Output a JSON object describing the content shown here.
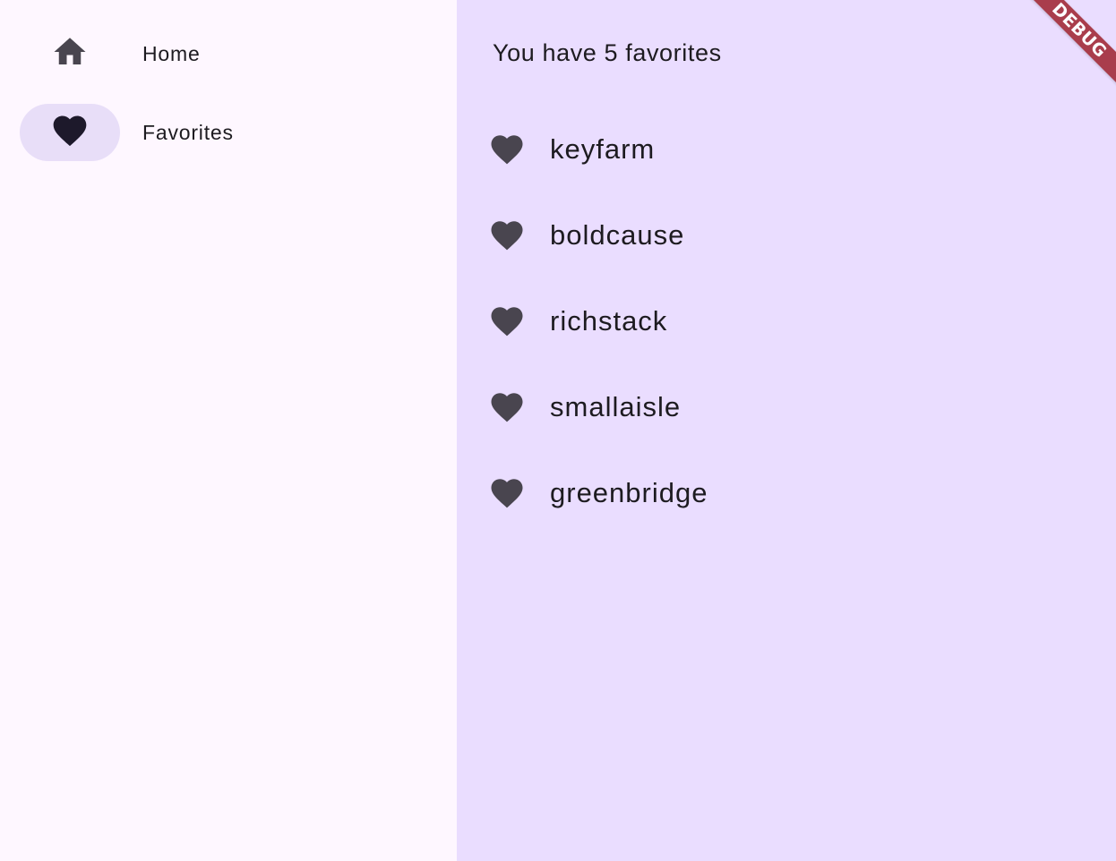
{
  "rail": {
    "destinations": [
      {
        "label": "Home",
        "icon": "home-icon",
        "selected": false
      },
      {
        "label": "Favorites",
        "icon": "heart-icon",
        "selected": true
      }
    ]
  },
  "favorites": {
    "count_text": "You have 5 favorites",
    "items": [
      {
        "name": "keyfarm",
        "icon": "heart-icon"
      },
      {
        "name": "boldcause",
        "icon": "heart-icon"
      },
      {
        "name": "richstack",
        "icon": "heart-icon"
      },
      {
        "name": "smallaisle",
        "icon": "heart-icon"
      },
      {
        "name": "greenbridge",
        "icon": "heart-icon"
      }
    ]
  },
  "debug_banner": {
    "label": "DEBUG"
  },
  "colors": {
    "rail_background": "#fef7ff",
    "main_background": "#eaddff",
    "selected_indicator": "#e8def8",
    "icon": "#49454f",
    "selected_icon": "#1d192b",
    "banner": "#a4303d"
  }
}
